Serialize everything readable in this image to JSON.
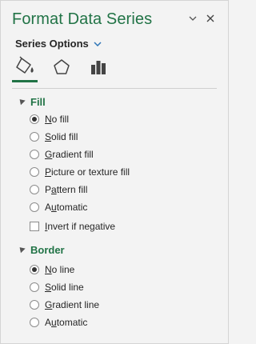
{
  "pane": {
    "title": "Format Data Series",
    "options_label": "Series Options",
    "tabs": [
      {
        "name": "fill-and-line-tab",
        "icon": "paint-bucket-icon",
        "active": true
      },
      {
        "name": "effects-tab",
        "icon": "pentagon-icon",
        "active": false
      },
      {
        "name": "series-options-tab",
        "icon": "bar-chart-icon",
        "active": false
      }
    ]
  },
  "fill": {
    "heading": "Fill",
    "options": [
      {
        "ul": "N",
        "rest": "o fill",
        "selected": true
      },
      {
        "ul": "S",
        "rest": "olid fill",
        "selected": false
      },
      {
        "ul": "G",
        "rest": "radient fill",
        "selected": false
      },
      {
        "ul": "P",
        "rest": "icture or texture fill",
        "selected": false
      },
      {
        "pre": "P",
        "ul": "a",
        "rest": "ttern fill",
        "selected": false
      },
      {
        "pre": "A",
        "ul": "u",
        "rest": "tomatic",
        "selected": false
      }
    ],
    "invert": {
      "ul": "I",
      "rest": "nvert if negative",
      "checked": false
    }
  },
  "border": {
    "heading": "Border",
    "options": [
      {
        "ul": "N",
        "rest": "o line",
        "selected": true
      },
      {
        "ul": "S",
        "rest": "olid line",
        "selected": false
      },
      {
        "ul": "G",
        "rest": "radient line",
        "selected": false
      },
      {
        "pre": "A",
        "ul": "u",
        "rest": "tomatic",
        "selected": false
      }
    ]
  },
  "colors": {
    "accent": "#217346",
    "background": "#f3f3f3"
  }
}
